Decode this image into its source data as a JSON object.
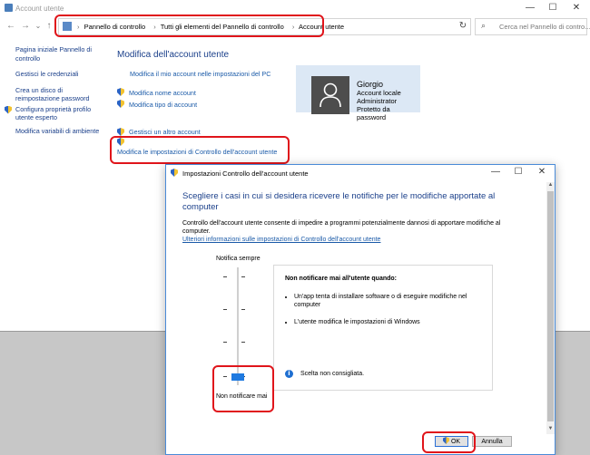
{
  "window": {
    "title": "Account utente",
    "minimize": "—",
    "maximize": "☐",
    "close": "✕"
  },
  "nav": {
    "back": "←",
    "forward": "→",
    "recent": "⌄",
    "up": "↑",
    "refresh": "↻"
  },
  "address": {
    "crumbs": [
      "Pannello di controllo",
      "Tutti gli elementi del Pannello di controllo",
      "Account utente"
    ],
    "separator": "›"
  },
  "search": {
    "placeholder": "Cerca nel Pannello di contro..."
  },
  "sidebar": {
    "items": [
      {
        "label": "Pagina iniziale Pannello di controllo"
      },
      {
        "label": "Gestisci le credenziali"
      },
      {
        "label": "Crea un disco di reimpostazione password"
      },
      {
        "label": "Configura proprietà profilo utente esperto"
      },
      {
        "label": "Modifica variabili di ambiente"
      }
    ]
  },
  "main": {
    "heading": "Modifica dell'account utente",
    "links": {
      "pc_settings": "Modifica il mio account nelle impostazioni del PC",
      "change_name": "Modifica nome account",
      "change_type": "Modifica tipo di account",
      "manage_other": "Gestisci un altro account",
      "uac_settings": "Modifica le impostazioni di Controllo dell'account utente"
    }
  },
  "user": {
    "name": "Giorgio",
    "details": [
      "Account locale",
      "Administrator",
      "Protetto da password"
    ]
  },
  "dialog": {
    "title": "Impostazioni Controllo dell'account utente",
    "heading": "Scegliere i casi in cui si desidera ricevere le notifiche per le modifiche apportate al computer",
    "description": "Controllo dell'account utente consente di impedire a programmi potenzialmente dannosi di apportare modifiche al computer.",
    "more_info_link": "Ulteriori informazioni sulle impostazioni di Controllo dell'account utente",
    "slider": {
      "top_label": "Notifica sempre",
      "bottom_label": "Non notificare mai",
      "level": 0,
      "levels": 4
    },
    "panel": {
      "heading": "Non notificare mai all'utente quando:",
      "bullets": [
        "Un'app tenta di installare software o di eseguire modifiche nel computer",
        "L'utente modifica le impostazioni di Windows"
      ],
      "note": "Scelta non consigliata.",
      "info_icon": "i"
    },
    "buttons": {
      "ok": "OK",
      "cancel": "Annulla"
    },
    "scroll": {
      "up": "▲",
      "down": "▼"
    }
  },
  "colors": {
    "highlight": "#e0151b",
    "link": "#1a5aa8",
    "heading": "#1a3f8a",
    "slider": "#1f7ae0"
  }
}
